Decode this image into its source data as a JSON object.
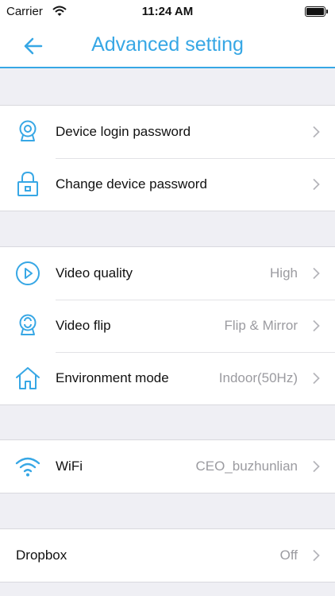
{
  "status_bar": {
    "carrier": "Carrier",
    "time": "11:24 AM"
  },
  "nav": {
    "title": "Advanced setting"
  },
  "colors": {
    "accent": "#37a7e5",
    "background": "#efeff4",
    "value_text": "#9b9ba0"
  },
  "groups": [
    {
      "rows": [
        {
          "icon": "camera-icon",
          "label": "Device login password",
          "value": ""
        },
        {
          "icon": "lock-icon",
          "label": "Change device password",
          "value": ""
        }
      ]
    },
    {
      "rows": [
        {
          "icon": "play-circle-icon",
          "label": "Video quality",
          "value": "High"
        },
        {
          "icon": "camera-flip-icon",
          "label": "Video flip",
          "value": "Flip & Mirror"
        },
        {
          "icon": "home-icon",
          "label": "Environment mode",
          "value": "Indoor(50Hz)"
        }
      ]
    },
    {
      "rows": [
        {
          "icon": "wifi-icon",
          "label": "WiFi",
          "value": "CEO_buzhunlian"
        }
      ]
    },
    {
      "rows": [
        {
          "icon": "",
          "label": "Dropbox",
          "value": "Off"
        }
      ]
    }
  ]
}
